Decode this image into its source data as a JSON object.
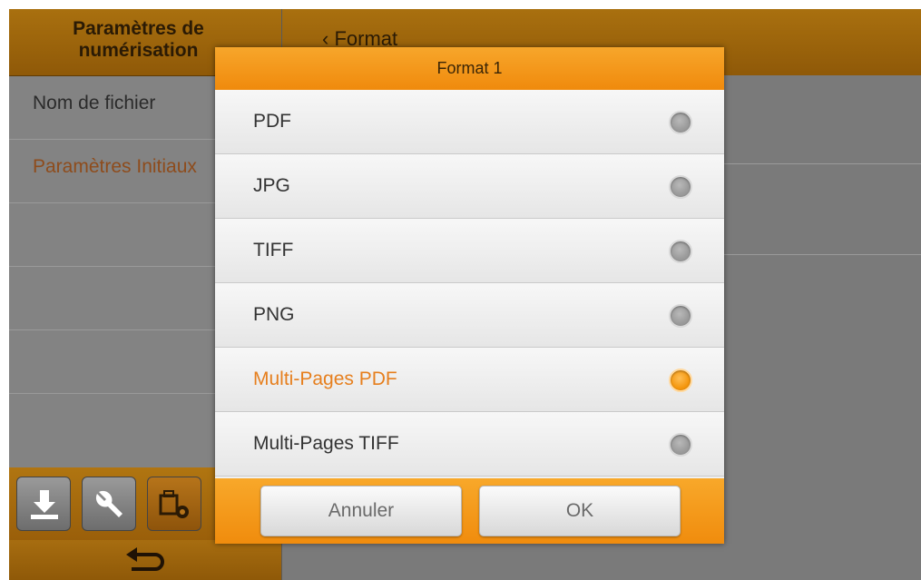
{
  "background": {
    "left_header_title": "Paramètres de numérisation",
    "left_items": [
      {
        "label": "Nom de fichier",
        "active": false
      },
      {
        "label": "Paramètres Initiaux",
        "active": true
      },
      {
        "label": "",
        "active": false
      },
      {
        "label": "",
        "active": false
      },
      {
        "label": "",
        "active": false
      }
    ],
    "toolbar_icons": [
      "download-icon",
      "wrench-icon",
      "scanner-settings-icon"
    ],
    "footer_icon": "back-arrow-icon",
    "right_header_title": "‹ Format"
  },
  "dialog": {
    "title": "Format 1",
    "options": [
      {
        "label": "PDF",
        "selected": false
      },
      {
        "label": "JPG",
        "selected": false
      },
      {
        "label": "TIFF",
        "selected": false
      },
      {
        "label": "PNG",
        "selected": false
      },
      {
        "label": "Multi-Pages PDF",
        "selected": true
      },
      {
        "label": "Multi-Pages TIFF",
        "selected": false
      }
    ],
    "cancel_label": "Annuler",
    "ok_label": "OK"
  },
  "colors": {
    "accent_orange": "#f08a0c",
    "selected_text": "#e67f1e",
    "header_brown": "#9a5f0a"
  }
}
